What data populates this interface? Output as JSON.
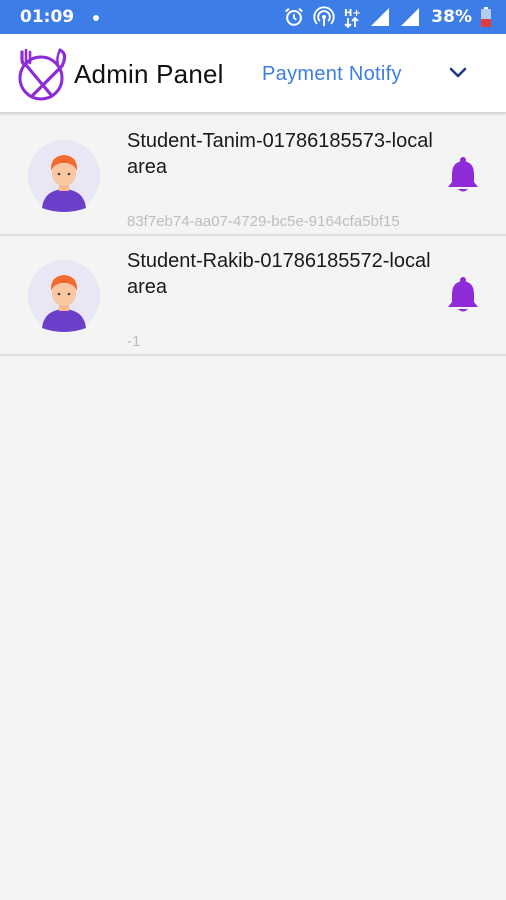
{
  "status_bar": {
    "time": "01:09",
    "battery": "38%",
    "icons": [
      "alarm-icon",
      "hotspot-icon",
      "data-arrows-icon",
      "signal-icon",
      "signal-icon",
      "battery-icon"
    ]
  },
  "app_bar": {
    "title": "Admin Panel",
    "page_selector": "Payment Notify",
    "logo_icon": "fork-knife-logo",
    "accent_color": "#3d7de8",
    "brand_color": "#8e2bd6"
  },
  "notifications": [
    {
      "title": "Student-Tanim-01786185573-local area",
      "subtitle": "83f7eb74-aa07-4729-bc5e-9164cfa5bf15",
      "action_icon": "bell-icon"
    },
    {
      "title": "Student-Rakib-01786185572-local area",
      "subtitle": "-1",
      "action_icon": "bell-icon"
    }
  ]
}
